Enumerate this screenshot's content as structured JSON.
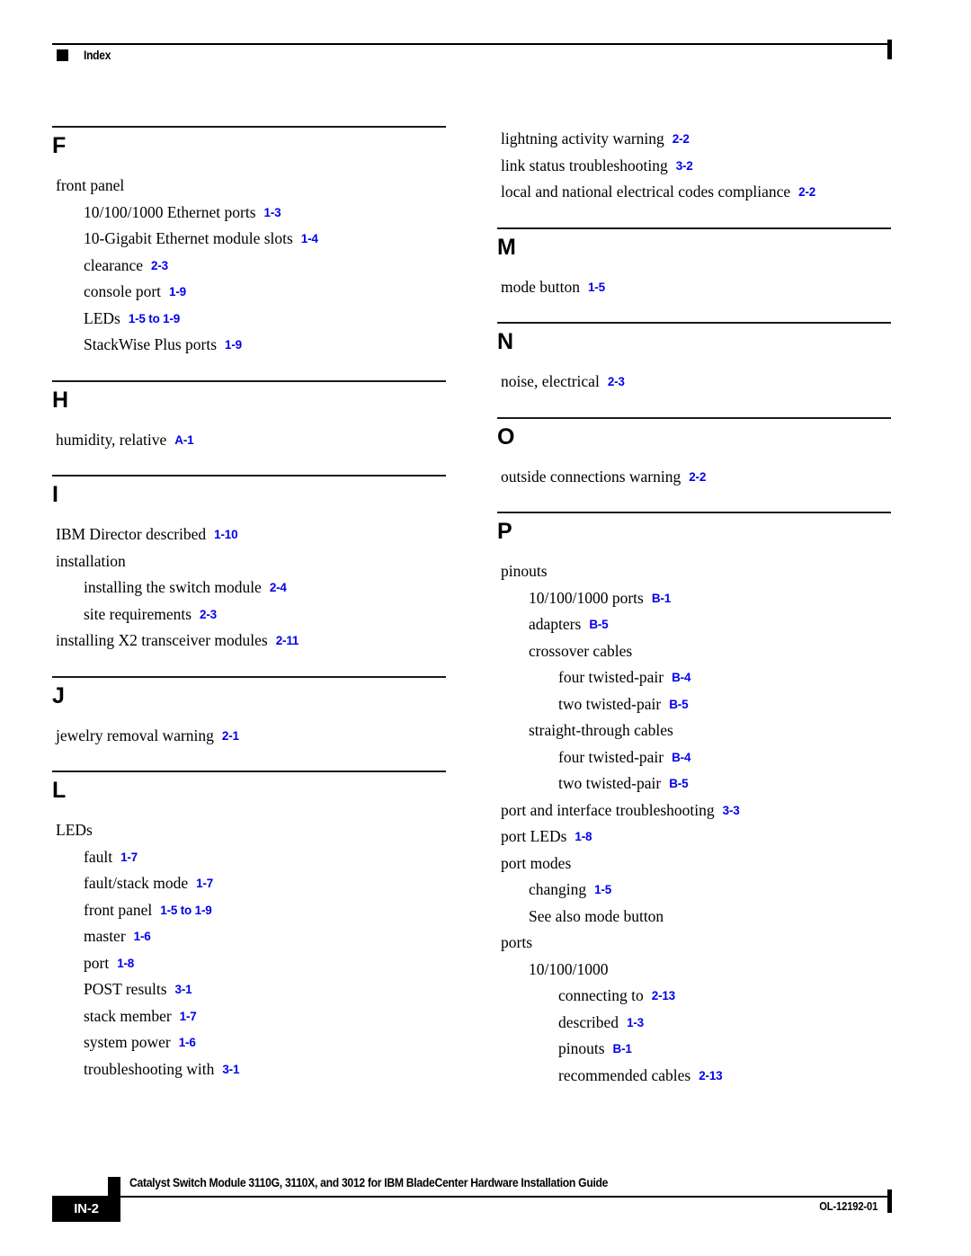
{
  "header": {
    "title": "Index",
    "marker_icon": "black-square-icon"
  },
  "footer": {
    "page_number": "IN-2",
    "document_title": "Catalyst Switch Module 3110G, 3110X, and 3012 for IBM BladeCenter Hardware Installation Guide",
    "document_id": "OL-12192-01",
    "marker_icon": "black-square-icon"
  },
  "accent_color": "#0000EE",
  "columns": [
    {
      "name": "left-column",
      "sections": [
        {
          "letter": "F",
          "entries": [
            {
              "level": 0,
              "text": "front panel",
              "ref": ""
            },
            {
              "level": 1,
              "text": "10/100/1000 Ethernet ports",
              "ref": "1-3"
            },
            {
              "level": 1,
              "text": "10-Gigabit Ethernet module slots",
              "ref": "1-4"
            },
            {
              "level": 1,
              "text": "clearance",
              "ref": "2-3"
            },
            {
              "level": 1,
              "text": "console port",
              "ref": "1-9"
            },
            {
              "level": 1,
              "text": "LEDs",
              "ref": "1-5 to 1-9"
            },
            {
              "level": 1,
              "text": "StackWise Plus ports",
              "ref": "1-9"
            }
          ]
        },
        {
          "letter": "H",
          "entries": [
            {
              "level": 0,
              "text": "humidity, relative",
              "ref": "A-1"
            }
          ]
        },
        {
          "letter": "I",
          "entries": [
            {
              "level": 0,
              "text": "IBM Director described",
              "ref": "1-10"
            },
            {
              "level": 0,
              "text": "installation",
              "ref": ""
            },
            {
              "level": 1,
              "text": "installing the switch module",
              "ref": "2-4"
            },
            {
              "level": 1,
              "text": "site requirements",
              "ref": "2-3"
            },
            {
              "level": 0,
              "text": "installing X2 transceiver modules",
              "ref": "2-11"
            }
          ]
        },
        {
          "letter": "J",
          "entries": [
            {
              "level": 0,
              "text": "jewelry removal warning",
              "ref": "2-1"
            }
          ]
        },
        {
          "letter": "L",
          "entries": [
            {
              "level": 0,
              "text": "LEDs",
              "ref": ""
            },
            {
              "level": 1,
              "text": "fault",
              "ref": "1-7"
            },
            {
              "level": 1,
              "text": "fault/stack mode",
              "ref": "1-7"
            },
            {
              "level": 1,
              "text": "front panel",
              "ref": "1-5 to 1-9"
            },
            {
              "level": 1,
              "text": "master",
              "ref": "1-6"
            },
            {
              "level": 1,
              "text": "port",
              "ref": "1-8"
            },
            {
              "level": 1,
              "text": "POST results",
              "ref": "3-1"
            },
            {
              "level": 1,
              "text": "stack member",
              "ref": "1-7"
            },
            {
              "level": 1,
              "text": "system power",
              "ref": "1-6"
            },
            {
              "level": 1,
              "text": "troubleshooting with",
              "ref": "3-1"
            }
          ]
        }
      ]
    },
    {
      "name": "right-column",
      "continued_entries": [
        {
          "level": 0,
          "text": "lightning activity warning",
          "ref": "2-2"
        },
        {
          "level": 0,
          "text": "link status troubleshooting",
          "ref": "3-2"
        },
        {
          "level": 0,
          "text": "local and national electrical codes compliance",
          "ref": "2-2"
        }
      ],
      "sections": [
        {
          "letter": "M",
          "entries": [
            {
              "level": 0,
              "text": "mode button",
              "ref": "1-5"
            }
          ]
        },
        {
          "letter": "N",
          "entries": [
            {
              "level": 0,
              "text": "noise, electrical",
              "ref": "2-3"
            }
          ]
        },
        {
          "letter": "O",
          "entries": [
            {
              "level": 0,
              "text": "outside connections warning",
              "ref": "2-2"
            }
          ]
        },
        {
          "letter": "P",
          "entries": [
            {
              "level": 0,
              "text": "pinouts",
              "ref": ""
            },
            {
              "level": 1,
              "text": "10/100/1000 ports",
              "ref": "B-1"
            },
            {
              "level": 1,
              "text": "adapters",
              "ref": "B-5"
            },
            {
              "level": 1,
              "text": "crossover cables",
              "ref": ""
            },
            {
              "level": 2,
              "text": "four twisted-pair",
              "ref": "B-4"
            },
            {
              "level": 2,
              "text": "two twisted-pair",
              "ref": "B-5"
            },
            {
              "level": 1,
              "text": "straight-through cables",
              "ref": ""
            },
            {
              "level": 2,
              "text": "four twisted-pair",
              "ref": "B-4"
            },
            {
              "level": 2,
              "text": "two twisted-pair",
              "ref": "B-5"
            },
            {
              "level": 0,
              "text": "port and interface troubleshooting",
              "ref": "3-3"
            },
            {
              "level": 0,
              "text": "port LEDs",
              "ref": "1-8"
            },
            {
              "level": 0,
              "text": "port modes",
              "ref": ""
            },
            {
              "level": 1,
              "text": "changing",
              "ref": "1-5"
            },
            {
              "level": 1,
              "text": "See also mode button",
              "ref": ""
            },
            {
              "level": 0,
              "text": "ports",
              "ref": ""
            },
            {
              "level": 1,
              "text": "10/100/1000",
              "ref": ""
            },
            {
              "level": 2,
              "text": "connecting to",
              "ref": "2-13"
            },
            {
              "level": 2,
              "text": "described",
              "ref": "1-3"
            },
            {
              "level": 2,
              "text": "pinouts",
              "ref": "B-1"
            },
            {
              "level": 2,
              "text": "recommended cables",
              "ref": "2-13"
            }
          ]
        }
      ]
    }
  ]
}
